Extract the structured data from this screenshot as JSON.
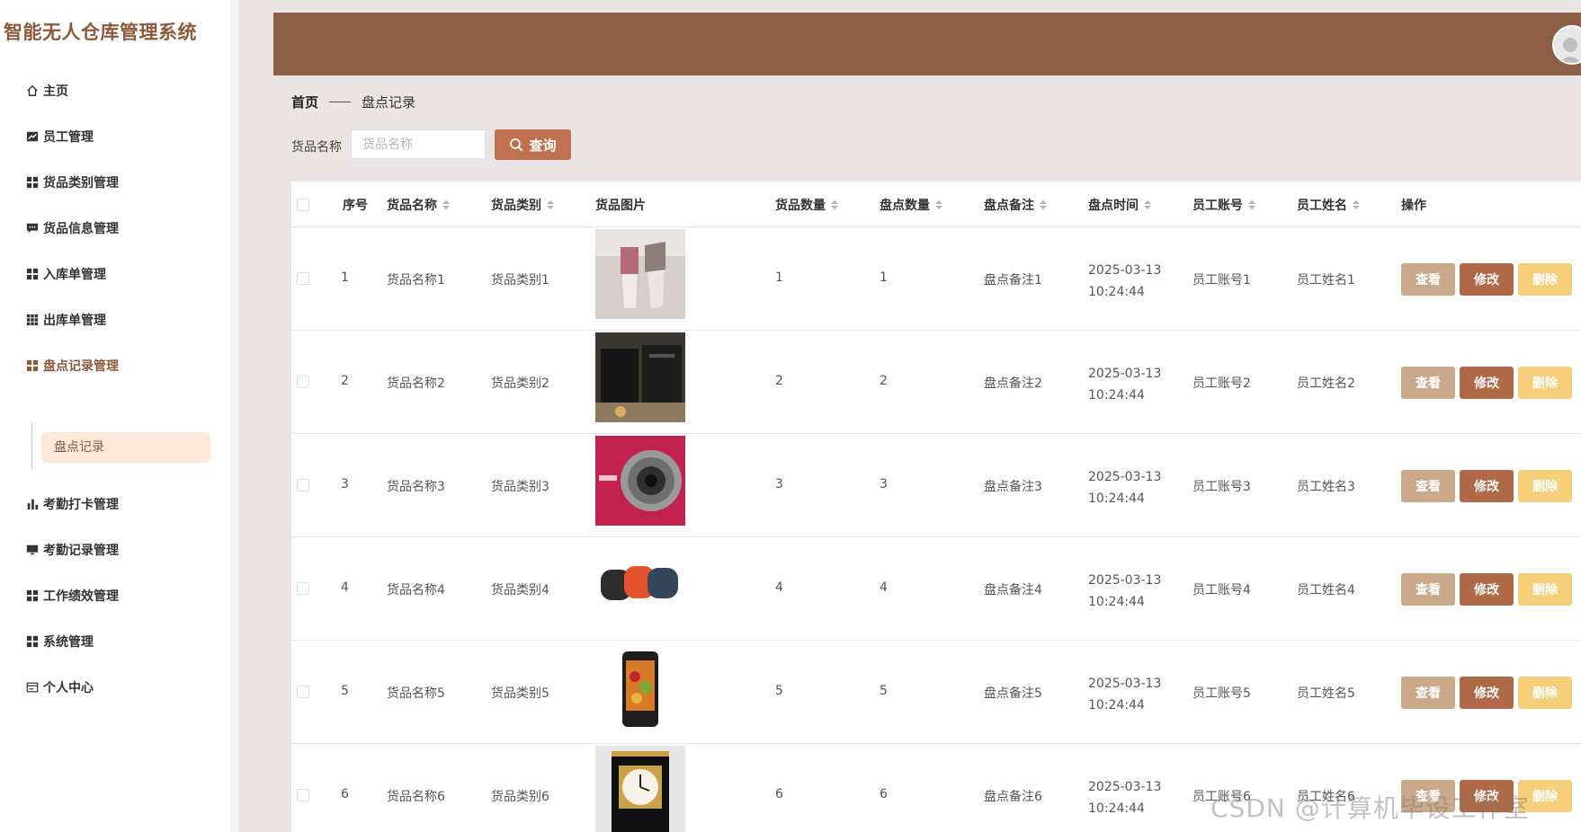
{
  "app": {
    "title": "智能无人仓库管理系统"
  },
  "sidebar": {
    "items": [
      {
        "label": "主页",
        "icon": "home-icon"
      },
      {
        "label": "员工管理",
        "icon": "chart-icon"
      },
      {
        "label": "货品类别管理",
        "icon": "grid-icon"
      },
      {
        "label": "货品信息管理",
        "icon": "comment-icon"
      },
      {
        "label": "入库单管理",
        "icon": "grid-icon"
      },
      {
        "label": "出库单管理",
        "icon": "grid-small-icon"
      },
      {
        "label": "盘点记录管理",
        "icon": "grid-icon"
      },
      {
        "label": "考勤打卡管理",
        "icon": "bar-chart-icon"
      },
      {
        "label": "考勤记录管理",
        "icon": "monitor-icon"
      },
      {
        "label": "工作绩效管理",
        "icon": "grid-icon"
      },
      {
        "label": "系统管理",
        "icon": "grid-icon"
      },
      {
        "label": "个人中心",
        "icon": "card-icon"
      }
    ],
    "submenu": {
      "label": "盘点记录"
    }
  },
  "breadcrumb": {
    "home": "首页",
    "current": "盘点记录"
  },
  "search": {
    "label": "货品名称",
    "placeholder": "货品名称",
    "button": "查询"
  },
  "table": {
    "headers": {
      "index": "序号",
      "name": "货品名称",
      "category": "货品类别",
      "image": "货品图片",
      "quantity": "货品数量",
      "counted": "盘点数量",
      "remark": "盘点备注",
      "time": "盘点时间",
      "account": "员工账号",
      "staff": "员工姓名",
      "actions": "操作"
    },
    "rows": [
      {
        "index": "1",
        "name": "货品名称1",
        "category": "货品类别1",
        "quantity": "1",
        "counted": "1",
        "remark": "盘点备注1",
        "time": "2025-03-13 10:24:44",
        "account": "员工账号1",
        "staff": "员工姓名1"
      },
      {
        "index": "2",
        "name": "货品名称2",
        "category": "货品类别2",
        "quantity": "2",
        "counted": "2",
        "remark": "盘点备注2",
        "time": "2025-03-13 10:24:44",
        "account": "员工账号2",
        "staff": "员工姓名2"
      },
      {
        "index": "3",
        "name": "货品名称3",
        "category": "货品类别3",
        "quantity": "3",
        "counted": "3",
        "remark": "盘点备注3",
        "time": "2025-03-13 10:24:44",
        "account": "员工账号3",
        "staff": "员工姓名3"
      },
      {
        "index": "4",
        "name": "货品名称4",
        "category": "货品类别4",
        "quantity": "4",
        "counted": "4",
        "remark": "盘点备注4",
        "time": "2025-03-13 10:24:44",
        "account": "员工账号4",
        "staff": "员工姓名4"
      },
      {
        "index": "5",
        "name": "货品名称5",
        "category": "货品类别5",
        "quantity": "5",
        "counted": "5",
        "remark": "盘点备注5",
        "time": "2025-03-13 10:24:44",
        "account": "员工账号5",
        "staff": "员工姓名5"
      },
      {
        "index": "6",
        "name": "货品名称6",
        "category": "货品类别6",
        "quantity": "6",
        "counted": "6",
        "remark": "盘点备注6",
        "time": "2025-03-13 10:24:44",
        "account": "员工账号6",
        "staff": "员工姓名6"
      }
    ],
    "actions": {
      "view": "查看",
      "edit": "修改",
      "delete": "删除"
    }
  },
  "watermark": "CSDN @计算机毕设工作室",
  "colors": {
    "brand": "#8b5a3c",
    "topbar": "#8b5e45",
    "search_button": "#c0714f",
    "view": "#c9a98a",
    "edit": "#b06a48",
    "delete": "#f5cf7a"
  }
}
